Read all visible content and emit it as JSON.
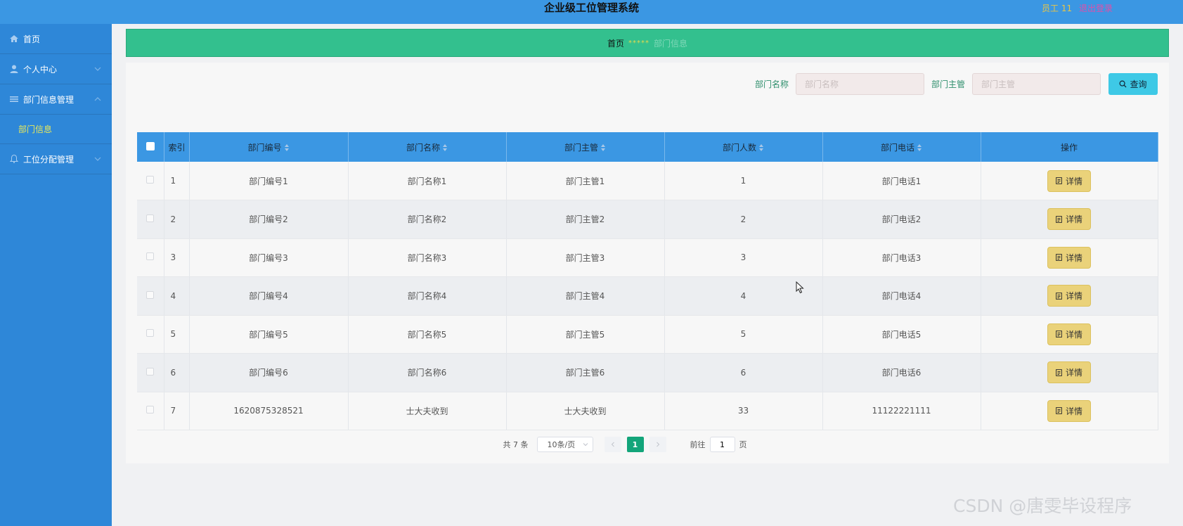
{
  "header": {
    "title": "企业级工位管理系统",
    "user": "员工 11",
    "logout": "退出登录"
  },
  "sidebar": {
    "items": [
      {
        "label": "首页"
      },
      {
        "label": "个人中心"
      },
      {
        "label": "部门信息管理"
      },
      {
        "label": "部门信息"
      },
      {
        "label": "工位分配管理"
      }
    ]
  },
  "breadcrumb": {
    "home": "首页",
    "separator": "*****",
    "current": "部门信息"
  },
  "search": {
    "name_label": "部门名称",
    "name_placeholder": "部门名称",
    "manager_label": "部门主管",
    "manager_placeholder": "部门主管",
    "button_label": "查询"
  },
  "table": {
    "columns": [
      "索引",
      "部门编号",
      "部门名称",
      "部门主管",
      "部门人数",
      "部门电话",
      "操作"
    ],
    "action_label": "详情",
    "rows": [
      {
        "index": "1",
        "code": "部门编号1",
        "name": "部门名称1",
        "manager": "部门主管1",
        "count": "1",
        "phone": "部门电话1"
      },
      {
        "index": "2",
        "code": "部门编号2",
        "name": "部门名称2",
        "manager": "部门主管2",
        "count": "2",
        "phone": "部门电话2"
      },
      {
        "index": "3",
        "code": "部门编号3",
        "name": "部门名称3",
        "manager": "部门主管3",
        "count": "3",
        "phone": "部门电话3"
      },
      {
        "index": "4",
        "code": "部门编号4",
        "name": "部门名称4",
        "manager": "部门主管4",
        "count": "4",
        "phone": "部门电话4"
      },
      {
        "index": "5",
        "code": "部门编号5",
        "name": "部门名称5",
        "manager": "部门主管5",
        "count": "5",
        "phone": "部门电话5"
      },
      {
        "index": "6",
        "code": "部门编号6",
        "name": "部门名称6",
        "manager": "部门主管6",
        "count": "6",
        "phone": "部门电话6"
      },
      {
        "index": "7",
        "code": "1620875328521",
        "name": "士大夫收到",
        "manager": "士大夫收到",
        "count": "33",
        "phone": "11122221111"
      }
    ]
  },
  "pagination": {
    "total": "共 7 条",
    "page_size": "10条/页",
    "current_page": "1",
    "goto_label": "前往",
    "goto_value": "1",
    "page_suffix": "页"
  },
  "watermark": "CSDN @唐雯毕设程序",
  "colors": {
    "header": "#3b97e3",
    "sidebar": "#2e87d8",
    "breadcrumb": "#33c08e",
    "search_button": "#3ec9e6",
    "detail_button": "#ead27a",
    "active_page": "#13a57a"
  }
}
